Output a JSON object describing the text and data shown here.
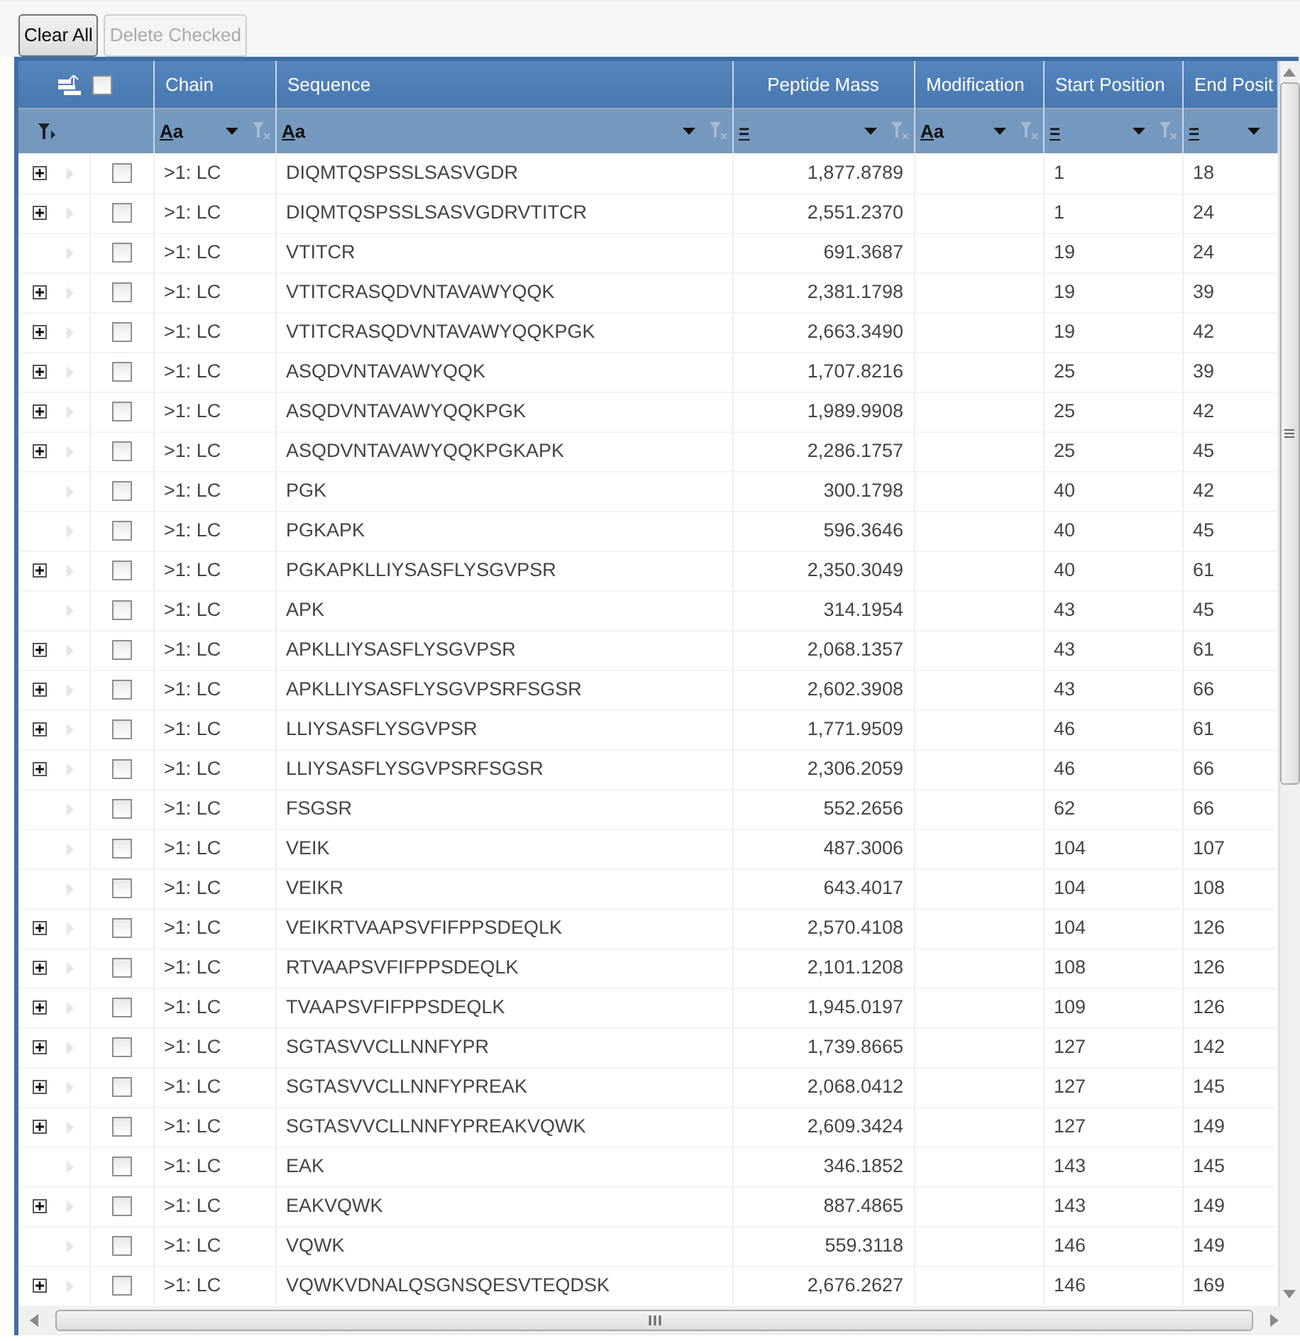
{
  "toolbar": {
    "buttons": [
      {
        "label": "Clear All",
        "disabled": false
      },
      {
        "label": "Delete Checked",
        "disabled": true
      }
    ]
  },
  "grid": {
    "select_all_checked": false,
    "columns": [
      {
        "label": "Chain",
        "filter": "Aa",
        "kind": "text",
        "clear_icon": true
      },
      {
        "label": "Sequence",
        "filter": "Aa",
        "kind": "text",
        "clear_icon": true
      },
      {
        "label": "Peptide Mass",
        "filter": "=",
        "kind": "mass",
        "clear_icon": true
      },
      {
        "label": "Modification",
        "filter": "Aa",
        "kind": "text",
        "clear_icon": true
      },
      {
        "label": "Start Position",
        "filter": "=",
        "kind": "position",
        "clear_icon": true
      },
      {
        "label": "End Posit",
        "filter": "=",
        "kind": "position",
        "clear_icon": false
      }
    ],
    "rows": [
      {
        "expandable": true,
        "checked": false,
        "cells": [
          ">1: LC",
          "DIQMTQSPSSLSASVGDR",
          "1,877.8789",
          "",
          "1",
          "18"
        ]
      },
      {
        "expandable": true,
        "checked": false,
        "cells": [
          ">1: LC",
          "DIQMTQSPSSLSASVGDRVTITCR",
          "2,551.2370",
          "",
          "1",
          "24"
        ]
      },
      {
        "expandable": false,
        "checked": false,
        "cells": [
          ">1: LC",
          "VTITCR",
          "691.3687",
          "",
          "19",
          "24"
        ]
      },
      {
        "expandable": true,
        "checked": false,
        "cells": [
          ">1: LC",
          "VTITCRASQDVNTAVAWYQQK",
          "2,381.1798",
          "",
          "19",
          "39"
        ]
      },
      {
        "expandable": true,
        "checked": false,
        "cells": [
          ">1: LC",
          "VTITCRASQDVNTAVAWYQQKPGK",
          "2,663.3490",
          "",
          "19",
          "42"
        ]
      },
      {
        "expandable": true,
        "checked": false,
        "cells": [
          ">1: LC",
          "ASQDVNTAVAWYQQK",
          "1,707.8216",
          "",
          "25",
          "39"
        ]
      },
      {
        "expandable": true,
        "checked": false,
        "cells": [
          ">1: LC",
          "ASQDVNTAVAWYQQKPGK",
          "1,989.9908",
          "",
          "25",
          "42"
        ]
      },
      {
        "expandable": true,
        "checked": false,
        "cells": [
          ">1: LC",
          "ASQDVNTAVAWYQQKPGKAPK",
          "2,286.1757",
          "",
          "25",
          "45"
        ]
      },
      {
        "expandable": false,
        "checked": false,
        "cells": [
          ">1: LC",
          "PGK",
          "300.1798",
          "",
          "40",
          "42"
        ]
      },
      {
        "expandable": false,
        "checked": false,
        "cells": [
          ">1: LC",
          "PGKAPK",
          "596.3646",
          "",
          "40",
          "45"
        ]
      },
      {
        "expandable": true,
        "checked": false,
        "cells": [
          ">1: LC",
          "PGKAPKLLIYSASFLYSGVPSR",
          "2,350.3049",
          "",
          "40",
          "61"
        ]
      },
      {
        "expandable": false,
        "checked": false,
        "cells": [
          ">1: LC",
          "APK",
          "314.1954",
          "",
          "43",
          "45"
        ]
      },
      {
        "expandable": true,
        "checked": false,
        "cells": [
          ">1: LC",
          "APKLLIYSASFLYSGVPSR",
          "2,068.1357",
          "",
          "43",
          "61"
        ]
      },
      {
        "expandable": true,
        "checked": false,
        "cells": [
          ">1: LC",
          "APKLLIYSASFLYSGVPSRFSGSR",
          "2,602.3908",
          "",
          "43",
          "66"
        ]
      },
      {
        "expandable": true,
        "checked": false,
        "cells": [
          ">1: LC",
          "LLIYSASFLYSGVPSR",
          "1,771.9509",
          "",
          "46",
          "61"
        ]
      },
      {
        "expandable": true,
        "checked": false,
        "cells": [
          ">1: LC",
          "LLIYSASFLYSGVPSRFSGSR",
          "2,306.2059",
          "",
          "46",
          "66"
        ]
      },
      {
        "expandable": false,
        "checked": false,
        "cells": [
          ">1: LC",
          "FSGSR",
          "552.2656",
          "",
          "62",
          "66"
        ]
      },
      {
        "expandable": false,
        "checked": false,
        "cells": [
          ">1: LC",
          "VEIK",
          "487.3006",
          "",
          "104",
          "107"
        ]
      },
      {
        "expandable": false,
        "checked": false,
        "cells": [
          ">1: LC",
          "VEIKR",
          "643.4017",
          "",
          "104",
          "108"
        ]
      },
      {
        "expandable": true,
        "checked": false,
        "cells": [
          ">1: LC",
          "VEIKRTVAAPSVFIFPPSDEQLK",
          "2,570.4108",
          "",
          "104",
          "126"
        ]
      },
      {
        "expandable": true,
        "checked": false,
        "cells": [
          ">1: LC",
          "RTVAAPSVFIFPPSDEQLK",
          "2,101.1208",
          "",
          "108",
          "126"
        ]
      },
      {
        "expandable": true,
        "checked": false,
        "cells": [
          ">1: LC",
          "TVAAPSVFIFPPSDEQLK",
          "1,945.0197",
          "",
          "109",
          "126"
        ]
      },
      {
        "expandable": true,
        "checked": false,
        "cells": [
          ">1: LC",
          "SGTASVVCLLNNFYPR",
          "1,739.8665",
          "",
          "127",
          "142"
        ]
      },
      {
        "expandable": true,
        "checked": false,
        "cells": [
          ">1: LC",
          "SGTASVVCLLNNFYPREAK",
          "2,068.0412",
          "",
          "127",
          "145"
        ]
      },
      {
        "expandable": true,
        "checked": false,
        "cells": [
          ">1: LC",
          "SGTASVVCLLNNFYPREAKVQWK",
          "2,609.3424",
          "",
          "127",
          "149"
        ]
      },
      {
        "expandable": false,
        "checked": false,
        "cells": [
          ">1: LC",
          "EAK",
          "346.1852",
          "",
          "143",
          "145"
        ]
      },
      {
        "expandable": true,
        "checked": false,
        "cells": [
          ">1: LC",
          "EAKVQWK",
          "887.4865",
          "",
          "143",
          "149"
        ]
      },
      {
        "expandable": false,
        "checked": false,
        "cells": [
          ">1: LC",
          "VQWK",
          "559.3118",
          "",
          "146",
          "149"
        ]
      },
      {
        "expandable": true,
        "checked": false,
        "cells": [
          ">1: LC",
          "VQWKVDNALQSGNSQESVTEQDSK",
          "2,676.2627",
          "",
          "146",
          "169"
        ]
      }
    ]
  }
}
